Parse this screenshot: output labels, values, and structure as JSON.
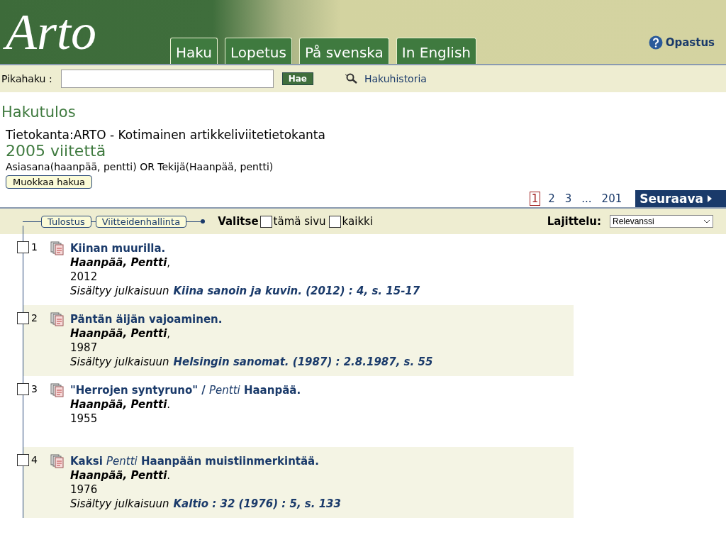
{
  "header": {
    "logo": "Arto",
    "tabs": [
      {
        "label": "Haku",
        "selected": false
      },
      {
        "label": "Lopetus",
        "selected": false
      },
      {
        "label": "På svenska",
        "selected": false
      },
      {
        "label": "In English",
        "selected": false
      }
    ],
    "help": "Opastus"
  },
  "quick_search": {
    "label": "Pikahaku :",
    "button": "Hae",
    "history": "Hakuhistoria"
  },
  "result_heading": "Hakutulos",
  "database": "Tietokanta:ARTO - Kotimainen artikkeliviitetietokanta",
  "count": "2005 viitettä",
  "query": "Asiasana(haanpää, pentti) OR Tekijä(Haanpää, pentti)",
  "edit_button": "Muokkaa hakua",
  "pagination": {
    "pages": [
      {
        "label": "1",
        "selected": true
      },
      {
        "label": "2",
        "selected": false
      },
      {
        "label": "3",
        "selected": false
      },
      {
        "label": "...",
        "selected": false
      },
      {
        "label": "201",
        "selected": false
      }
    ],
    "next": "Seuraava"
  },
  "toolbar": {
    "buttons": [
      "Tulostus",
      "Viitteidenhallinta"
    ],
    "select_label": "Valitse",
    "options": [
      {
        "label": "tämä sivu",
        "checked": false
      },
      {
        "label": "kaikki",
        "checked": false
      }
    ],
    "sort_label": "Lajittelu:",
    "sort_value": "Relevanssi"
  },
  "results": [
    {
      "number": "1",
      "checked": false,
      "title": "Kiinan muurilla.",
      "author": "**Haanpää, Pentti**,",
      "year": "2012",
      "source_label": "Sisältyy julkaisuun",
      "source": "Kiina sanoin ja kuvin. (2012) : 4, s. 15-17"
    },
    {
      "number": "2",
      "checked": false,
      "title": "Päntän äijän vajoaminen.",
      "author": "**Haanpää, Pentti**,",
      "year": "1987",
      "source_label": "Sisältyy julkaisuun",
      "source": "Helsingin sanomat. (1987) : 2.8.1987, s. 55"
    },
    {
      "number": "3",
      "checked": false,
      "title": "\"Herrojen syntyruno\" / *Pentti* Haanpää.",
      "author": "**Haanpää, Pentti**.",
      "year": "1955"
    },
    {
      "number": "4",
      "checked": false,
      "title": "Kaksi *Pentti* Haanpään muistiinmerkintää.",
      "author": "**Haanpää, Pentti**.",
      "year": "1976",
      "source_label": "Sisältyy julkaisuun",
      "source": "Kaltio : 32 (1976) : 5, s. 133"
    }
  ]
}
